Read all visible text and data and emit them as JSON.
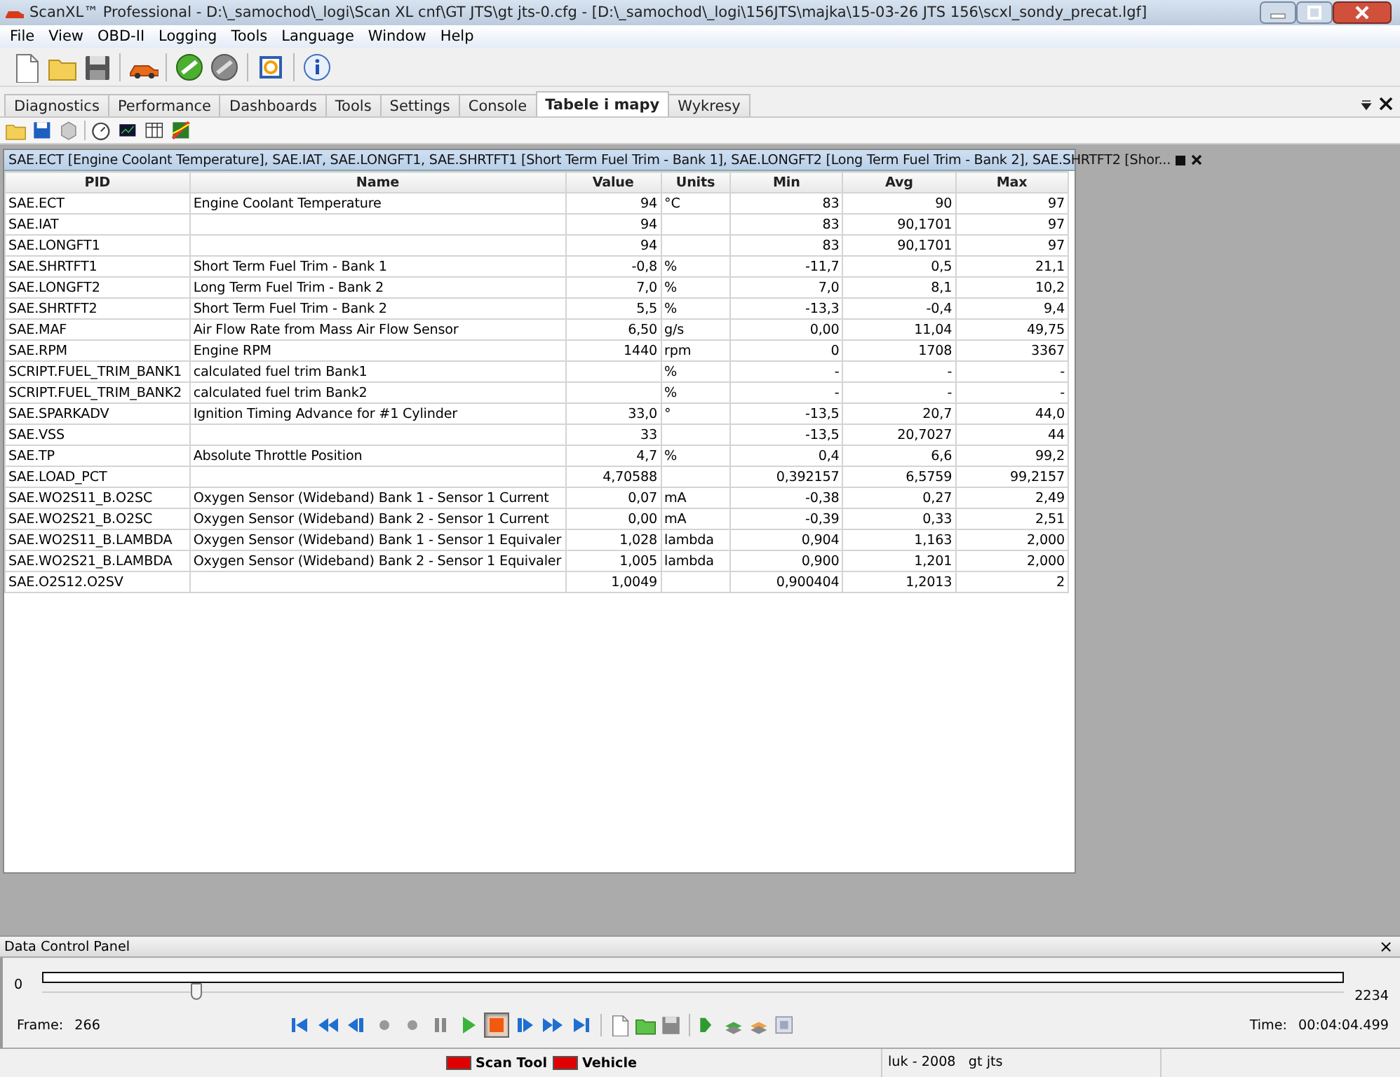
{
  "window": {
    "title": "ScanXL™ Professional - D:\\_samochod\\_logi\\Scan XL cnf\\GT JTS\\gt jts-0.cfg - [D:\\_samochod\\_logi\\156JTS\\majka\\15-03-26 JTS 156\\scxl_sondy_precat.lgf]"
  },
  "menu": [
    "File",
    "View",
    "OBD-II",
    "Logging",
    "Tools",
    "Language",
    "Window",
    "Help"
  ],
  "tabs": [
    {
      "label": "Diagnostics",
      "selected": false
    },
    {
      "label": "Performance",
      "selected": false
    },
    {
      "label": "Dashboards",
      "selected": false
    },
    {
      "label": "Tools",
      "selected": false
    },
    {
      "label": "Settings",
      "selected": false
    },
    {
      "label": "Console",
      "selected": false
    },
    {
      "label": "Tabele i mapy",
      "selected": true
    },
    {
      "label": "Wykresy",
      "selected": false
    }
  ],
  "table_panel": {
    "title": "SAE.ECT [Engine Coolant Temperature], SAE.IAT, SAE.LONGFT1, SAE.SHRTFT1 [Short Term Fuel Trim - Bank 1], SAE.LONGFT2 [Long Term Fuel Trim - Bank 2], SAE.SHRTFT2 [Shor...",
    "columns": [
      "PID",
      "Name",
      "Value",
      "Units",
      "Min",
      "Avg",
      "Max"
    ],
    "rows": [
      [
        "SAE.ECT",
        "Engine Coolant Temperature",
        "94",
        "°C",
        "83",
        "90",
        "97"
      ],
      [
        "SAE.IAT",
        "",
        "94",
        "",
        "83",
        "90,1701",
        "97"
      ],
      [
        "SAE.LONGFT1",
        "",
        "94",
        "",
        "83",
        "90,1701",
        "97"
      ],
      [
        "SAE.SHRTFT1",
        "Short Term Fuel Trim - Bank 1",
        "-0,8",
        "%",
        "-11,7",
        "0,5",
        "21,1"
      ],
      [
        "SAE.LONGFT2",
        "Long Term Fuel Trim - Bank 2",
        "7,0",
        "%",
        "7,0",
        "8,1",
        "10,2"
      ],
      [
        "SAE.SHRTFT2",
        "Short Term Fuel Trim - Bank 2",
        "5,5",
        "%",
        "-13,3",
        "-0,4",
        "9,4"
      ],
      [
        "SAE.MAF",
        "Air Flow Rate from Mass Air Flow Sensor",
        "6,50",
        "g/s",
        "0,00",
        "11,04",
        "49,75"
      ],
      [
        "SAE.RPM",
        "Engine RPM",
        "1440",
        "rpm",
        "0",
        "1708",
        "3367"
      ],
      [
        "SCRIPT.FUEL_TRIM_BANK1",
        "calculated fuel trim Bank1",
        "",
        "%",
        "-",
        "-",
        "-"
      ],
      [
        "SCRIPT.FUEL_TRIM_BANK2",
        "calculated fuel trim Bank2",
        "",
        "%",
        "-",
        "-",
        "-"
      ],
      [
        "SAE.SPARKADV",
        "Ignition Timing Advance for #1 Cylinder",
        "33,0",
        "°",
        "-13,5",
        "20,7",
        "44,0"
      ],
      [
        "SAE.VSS",
        "",
        "33",
        "",
        "-13,5",
        "20,7027",
        "44"
      ],
      [
        "SAE.TP",
        "Absolute Throttle Position",
        "4,7",
        "%",
        "0,4",
        "6,6",
        "99,2"
      ],
      [
        "SAE.LOAD_PCT",
        "",
        "4,70588",
        "",
        "0,392157",
        "6,5759",
        "99,2157"
      ],
      [
        "SAE.WO2S11_B.O2SC",
        "Oxygen Sensor (Wideband) Bank 1 - Sensor 1 Current",
        "0,07",
        "mA",
        "-0,38",
        "0,27",
        "2,49"
      ],
      [
        "SAE.WO2S21_B.O2SC",
        "Oxygen Sensor (Wideband) Bank 2 - Sensor 1 Current",
        "0,00",
        "mA",
        "-0,39",
        "0,33",
        "2,51"
      ],
      [
        "SAE.WO2S11_B.LAMBDA",
        "Oxygen Sensor (Wideband) Bank 1 - Sensor 1 Equivaler",
        "1,028",
        "lambda",
        "0,904",
        "1,163",
        "2,000"
      ],
      [
        "SAE.WO2S21_B.LAMBDA",
        "Oxygen Sensor (Wideband) Bank 2 - Sensor 1 Equivaler",
        "1,005",
        "lambda",
        "0,900",
        "1,201",
        "2,000"
      ],
      [
        "SAE.O2S12.O2SV",
        "",
        "1,0049",
        "",
        "0,900404",
        "1,2013",
        "2"
      ]
    ]
  },
  "data_control_panel": {
    "title": "Data Control Panel",
    "close": "×",
    "range_start": "0",
    "range_end": "2234",
    "slider": {
      "level": 0.119
    },
    "frame_label": "Frame:",
    "frame": "266",
    "time_label": "Time:",
    "time": "00:04:04.499",
    "transport": [
      {
        "kind": "first",
        "pressed": false
      },
      {
        "kind": "rewind",
        "pressed": false
      },
      {
        "kind": "step-back",
        "pressed": false
      },
      {
        "kind": "dot",
        "pressed": false
      },
      {
        "kind": "dot",
        "pressed": false
      },
      {
        "kind": "pause",
        "pressed": false
      },
      {
        "kind": "play",
        "pressed": false
      },
      {
        "kind": "stop",
        "pressed": true
      },
      {
        "kind": "step-forward",
        "pressed": false
      },
      {
        "kind": "forward",
        "pressed": false
      },
      {
        "kind": "last",
        "pressed": false
      }
    ]
  },
  "status_bar": {
    "indicators": [
      {
        "label": "Scan Tool",
        "color": "#e00000"
      },
      {
        "label": "Vehicle",
        "color": "#e00000"
      }
    ],
    "profile": "luk - 2008   gt jts"
  }
}
